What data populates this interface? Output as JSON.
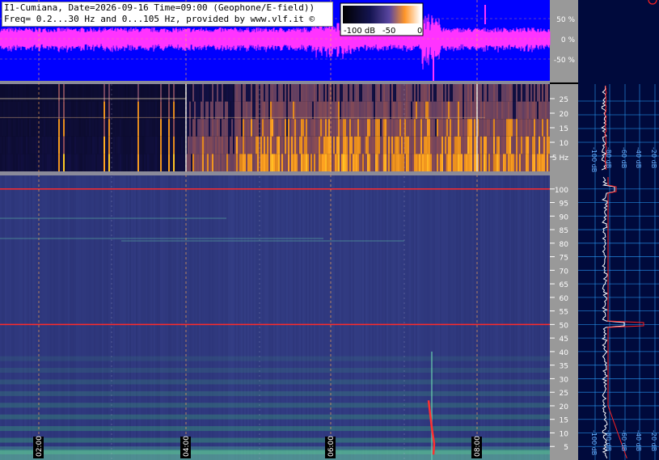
{
  "header": {
    "line1": "I1-Cumiana, Date=2026-09-16 Time=09:00 (Geophone/E-field))",
    "line2": "Freq= 0.2...30 Hz and 0...105 Hz, provided by www.vlf.it ©"
  },
  "colorbar": {
    "labels": [
      "-100 dB",
      "-50",
      "0"
    ]
  },
  "colors": {
    "waveform_bg": "#0000ff",
    "waveform_trace": "#ff33ff",
    "grid": "#ffaa55",
    "right_panel_bg": "#000a3c",
    "right_panel_grid": "#2aa0ff",
    "spectrum_trace": "#ffffff",
    "average_trace": "#ff2020",
    "axis_bg": "#999999"
  },
  "chart_data": [
    {
      "type": "line",
      "panel": "waveform",
      "y_unit": "%",
      "yticks": [
        "50 %",
        "0 %",
        "-50 %"
      ],
      "ylim": [
        -100,
        100
      ]
    },
    {
      "type": "heatmap",
      "panel": "spectrogram_low",
      "y_unit": "Hz",
      "ylim": [
        0,
        30
      ],
      "yticks": [
        "25",
        "20",
        "15",
        "10",
        "5 Hz"
      ],
      "color_scale_db": [
        -100,
        0
      ]
    },
    {
      "type": "heatmap",
      "panel": "spectrogram_high",
      "y_unit": "Hz",
      "ylim": [
        0,
        105
      ],
      "yticks": [
        "100",
        "95",
        "90",
        "85",
        "80",
        "75",
        "70",
        "65",
        "60",
        "55",
        "50",
        "45",
        "40",
        "35",
        "30",
        "25",
        "20",
        "15",
        "10",
        "5"
      ],
      "xticks": [
        "02:00",
        "04:00",
        "06:00",
        "08:00"
      ],
      "strong_lines_hz": [
        50,
        100
      ]
    },
    {
      "type": "line",
      "panel": "spectrum_low",
      "xticks": [
        "-100 dB",
        "-80 dB",
        "-60 dB",
        "-40 dB",
        "-20 dB"
      ]
    },
    {
      "type": "line",
      "panel": "spectrum_high",
      "xticks": [
        "-100 dB",
        "-80 dB",
        "-60 dB",
        "-40 dB",
        "-20 dB"
      ],
      "peaks_hz": [
        50,
        100
      ]
    }
  ]
}
